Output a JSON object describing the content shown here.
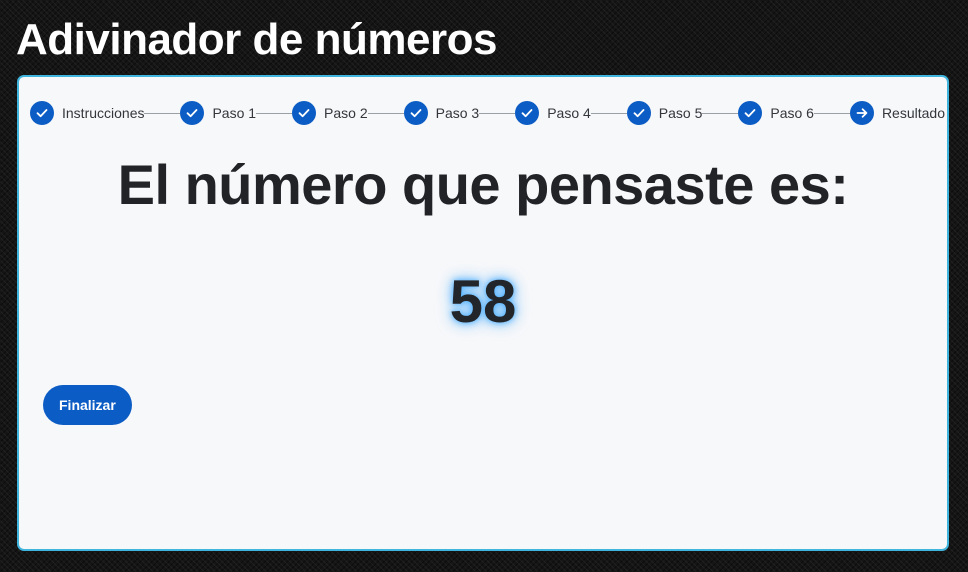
{
  "app": {
    "title": "Adivinador de números"
  },
  "stepper": {
    "steps": [
      {
        "label": "Instrucciones",
        "status": "completed",
        "icon": "check-icon"
      },
      {
        "label": "Paso 1",
        "status": "completed",
        "icon": "check-icon"
      },
      {
        "label": "Paso 2",
        "status": "completed",
        "icon": "check-icon"
      },
      {
        "label": "Paso 3",
        "status": "completed",
        "icon": "check-icon"
      },
      {
        "label": "Paso 4",
        "status": "completed",
        "icon": "check-icon"
      },
      {
        "label": "Paso 5",
        "status": "completed",
        "icon": "check-icon"
      },
      {
        "label": "Paso 6",
        "status": "completed",
        "icon": "check-icon"
      },
      {
        "label": "Resultado",
        "status": "current",
        "icon": "arrow-right-icon"
      }
    ]
  },
  "result": {
    "heading": "El número que pensaste es:",
    "number": "58"
  },
  "actions": {
    "finish_label": "Finalizar"
  },
  "colors": {
    "accent": "#0b5cc4",
    "card_border": "#3fb4dc",
    "number_glow": "#40aaff",
    "card_background": "#f7f8fa"
  }
}
